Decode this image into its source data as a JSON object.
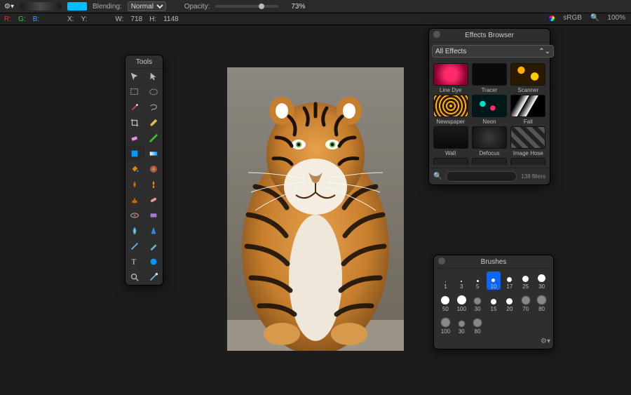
{
  "toolbar": {
    "blending_label": "Blending:",
    "blending_value": "Normal",
    "opacity_label": "Opacity:",
    "opacity_value": "73%",
    "opacity_frac": 0.73,
    "swatch_color": "#00bdff"
  },
  "info": {
    "R": "R:",
    "G": "G:",
    "B": "B:",
    "X": "X:",
    "Y": "Y:",
    "W_label": "W:",
    "W_value": "718",
    "H_label": "H:",
    "H_value": "1148",
    "color_profile": "sRGB",
    "zoom": "100%"
  },
  "tools_panel": {
    "title": "Tools"
  },
  "effects_panel": {
    "title": "Effects Browser",
    "filter_select": "All Effects",
    "items": [
      {
        "label": "Line Dye",
        "bg": "radial-gradient(circle,#ff2a6a 30%,#870033 80%)"
      },
      {
        "label": "Tracer",
        "bg": "#0a0a0a"
      },
      {
        "label": "Scanner",
        "bg": "radial-gradient(circle at 30% 30%,#ffb300 12%,transparent 14%),radial-gradient(circle at 70% 60%,#ffcc00 14%,transparent 16%),#2a1a00"
      },
      {
        "label": "Newspaper",
        "bg": "repeating-radial-gradient(circle,#ffb300 0 2px,#2a1a00 2px 5px)"
      },
      {
        "label": "Neon",
        "bg": "radial-gradient(circle at 30% 40%,#00e0d0 10%,transparent 12%),radial-gradient(circle at 60% 60%,#ff2a6a 10%,transparent 12%),#001818"
      },
      {
        "label": "Fall",
        "bg": "linear-gradient(300deg,#000 40%,#fff 41%,#000 60%,#fff 61%,#000 80%)"
      },
      {
        "label": "Wall",
        "bg": "linear-gradient(#1a1a1a,#0a0a0a)"
      },
      {
        "label": "Defocus",
        "bg": "radial-gradient(circle,#3a3a3a,#111)"
      },
      {
        "label": "Image Hose",
        "bg": "repeating-linear-gradient(45deg,#555 0 6px,#222 6px 12px)"
      }
    ],
    "filter_count": "138 filters"
  },
  "brushes_panel": {
    "title": "Brushes",
    "rows": [
      [
        {
          "n": "1",
          "d": 1
        },
        {
          "n": "3",
          "d": 2
        },
        {
          "n": "5",
          "d": 3
        },
        {
          "n": "10",
          "d": 5,
          "sel": true
        },
        {
          "n": "17",
          "d": 7
        },
        {
          "n": "25",
          "d": 9
        },
        {
          "n": "30",
          "d": 11
        }
      ],
      [
        {
          "n": "50",
          "d": 12
        },
        {
          "n": "100",
          "d": 13
        },
        {
          "n": "30",
          "d": 10,
          "tex": true
        },
        {
          "n": "15",
          "d": 8
        },
        {
          "n": "20",
          "d": 9
        },
        {
          "n": "70",
          "d": 12,
          "tex": true
        },
        {
          "n": "80",
          "d": 13,
          "tex": true
        }
      ],
      [
        {
          "n": "100",
          "d": 13,
          "tex": true
        },
        {
          "n": "30",
          "d": 9,
          "tex": true
        },
        {
          "n": "80",
          "d": 12,
          "tex": true
        }
      ]
    ]
  }
}
